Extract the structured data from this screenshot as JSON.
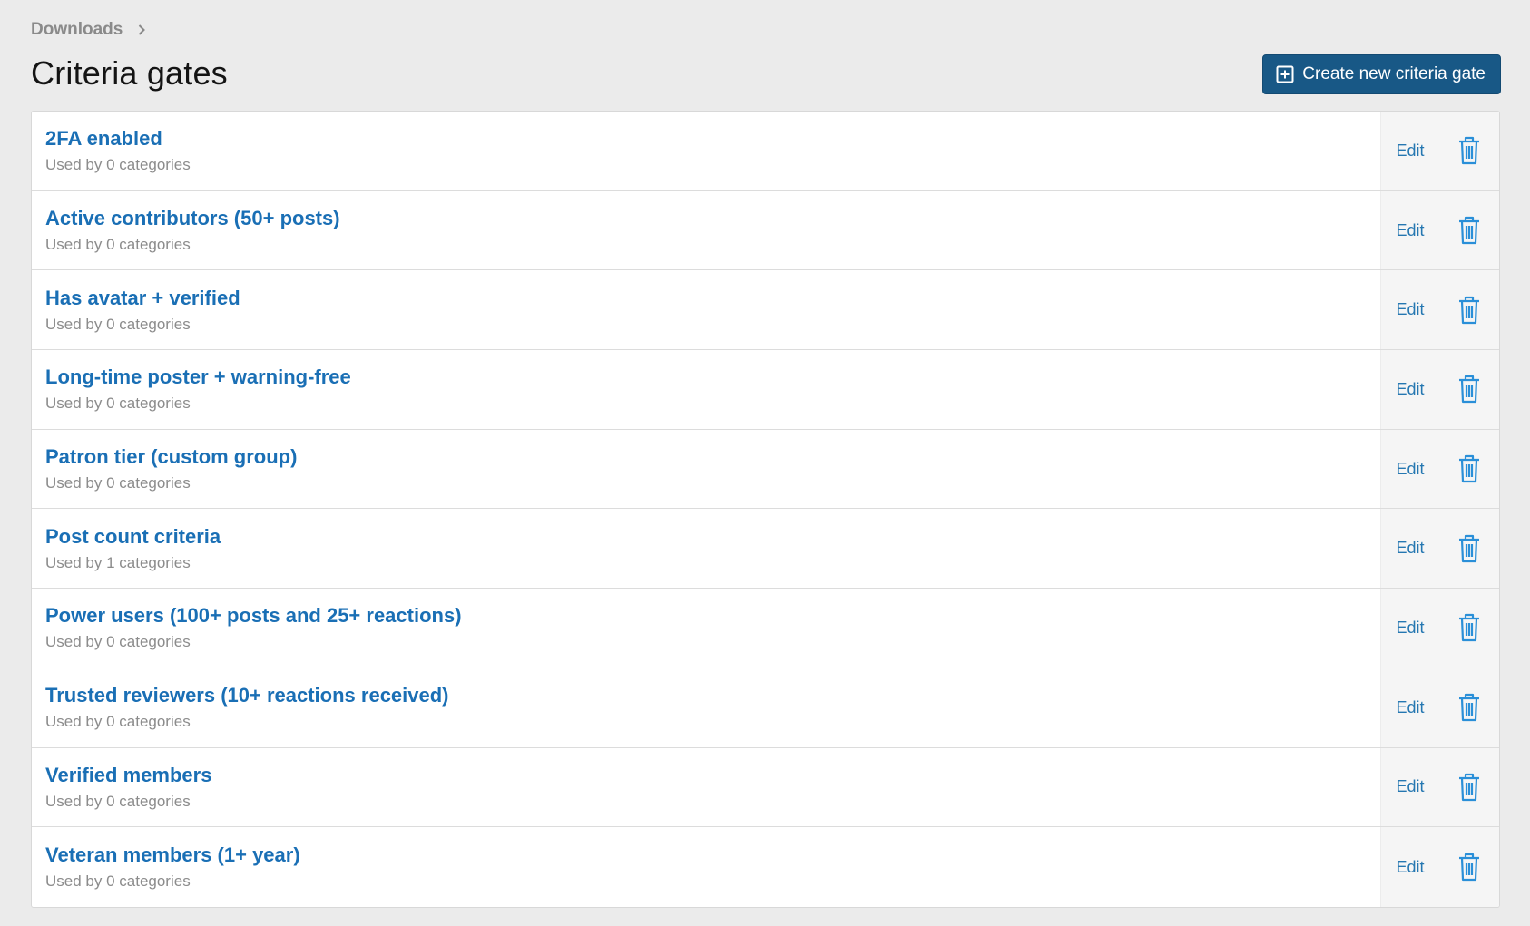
{
  "breadcrumb": {
    "items": [
      "Downloads"
    ]
  },
  "page": {
    "title": "Criteria gates"
  },
  "toolbar": {
    "create_label": "Create new criteria gate"
  },
  "colors": {
    "accent": "#185886",
    "link": "#1a6fb5",
    "icon": "#2a8fd8"
  },
  "icons": {
    "create": "plus-square-icon",
    "delete": "trash-icon",
    "breadcrumb_separator": "chevron-right-icon"
  },
  "gates": [
    {
      "title": "2FA enabled",
      "usage": "Used by 0 categories",
      "edit_label": "Edit"
    },
    {
      "title": "Active contributors (50+ posts)",
      "usage": "Used by 0 categories",
      "edit_label": "Edit"
    },
    {
      "title": "Has avatar + verified",
      "usage": "Used by 0 categories",
      "edit_label": "Edit"
    },
    {
      "title": "Long-time poster + warning-free",
      "usage": "Used by 0 categories",
      "edit_label": "Edit"
    },
    {
      "title": "Patron tier (custom group)",
      "usage": "Used by 0 categories",
      "edit_label": "Edit"
    },
    {
      "title": "Post count criteria",
      "usage": "Used by 1 categories",
      "edit_label": "Edit"
    },
    {
      "title": "Power users (100+ posts and 25+ reactions)",
      "usage": "Used by 0 categories",
      "edit_label": "Edit"
    },
    {
      "title": "Trusted reviewers (10+ reactions received)",
      "usage": "Used by 0 categories",
      "edit_label": "Edit"
    },
    {
      "title": "Verified members",
      "usage": "Used by 0 categories",
      "edit_label": "Edit"
    },
    {
      "title": "Veteran members (1+ year)",
      "usage": "Used by 0 categories",
      "edit_label": "Edit"
    }
  ]
}
